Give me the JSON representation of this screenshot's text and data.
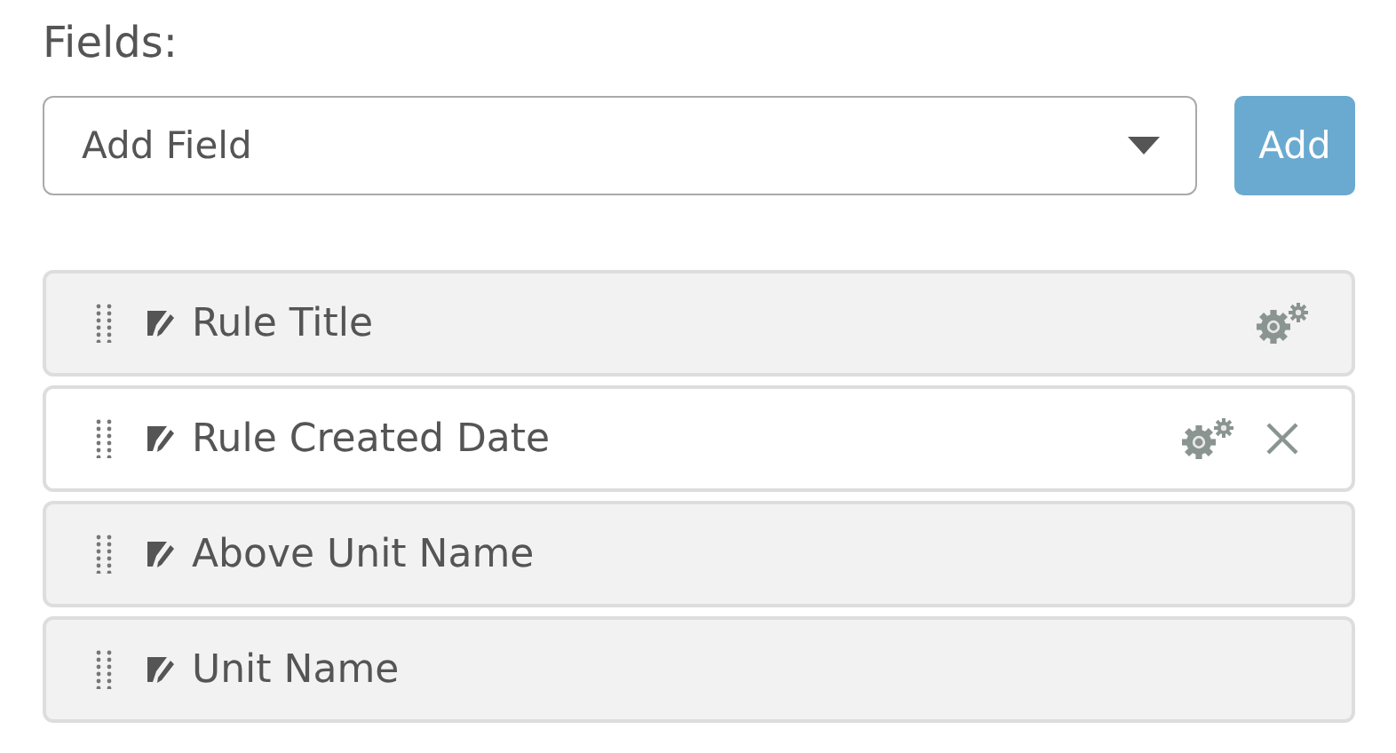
{
  "label": "Fields:",
  "select": {
    "value": "Add Field"
  },
  "add_button": "Add",
  "fields": [
    {
      "name": "Rule Title",
      "highlighted": false,
      "settings": true,
      "remove": false
    },
    {
      "name": "Rule Created Date",
      "highlighted": true,
      "settings": true,
      "remove": true
    },
    {
      "name": "Above Unit Name",
      "highlighted": false,
      "settings": false,
      "remove": false
    },
    {
      "name": "Unit Name",
      "highlighted": false,
      "settings": false,
      "remove": false
    }
  ]
}
